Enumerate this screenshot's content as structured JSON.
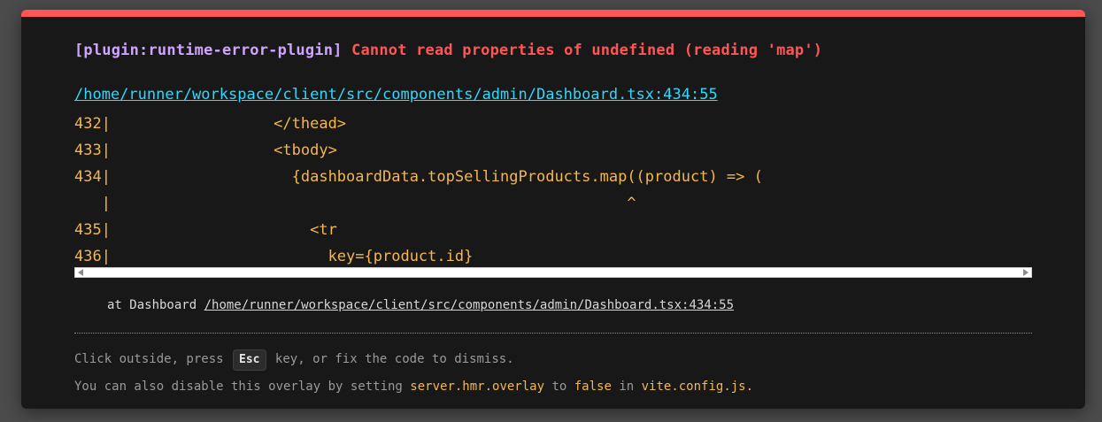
{
  "overlay": {
    "accent_color": "#ff5555",
    "plugin_label": "[plugin:runtime-error-plugin]",
    "message": "Cannot read properties of undefined (reading 'map')",
    "file_link": "/home/runner/workspace/client/src/components/admin/Dashboard.tsx:434:55",
    "code_frame": [
      "432|                  </thead>",
      "433|                  <tbody>",
      "434|                    {dashboardData.topSellingProducts.map((product) => (",
      "   |                                                         ^",
      "435|                      <tr",
      "436|                        key={product.id}"
    ],
    "stack_prefix": "at Dashboard",
    "stack_link": "/home/runner/workspace/client/src/components/admin/Dashboard.tsx:434:55",
    "tip1_before": "Click outside, press ",
    "tip1_key": "Esc",
    "tip1_after": " key, or fix the code to dismiss.",
    "tip2_before": "You can also disable this overlay by setting ",
    "tip2_setting": "server.hmr.overlay",
    "tip2_mid1": " to ",
    "tip2_value": "false",
    "tip2_mid2": " in ",
    "tip2_file": "vite.config.js",
    "tip2_end": "."
  }
}
